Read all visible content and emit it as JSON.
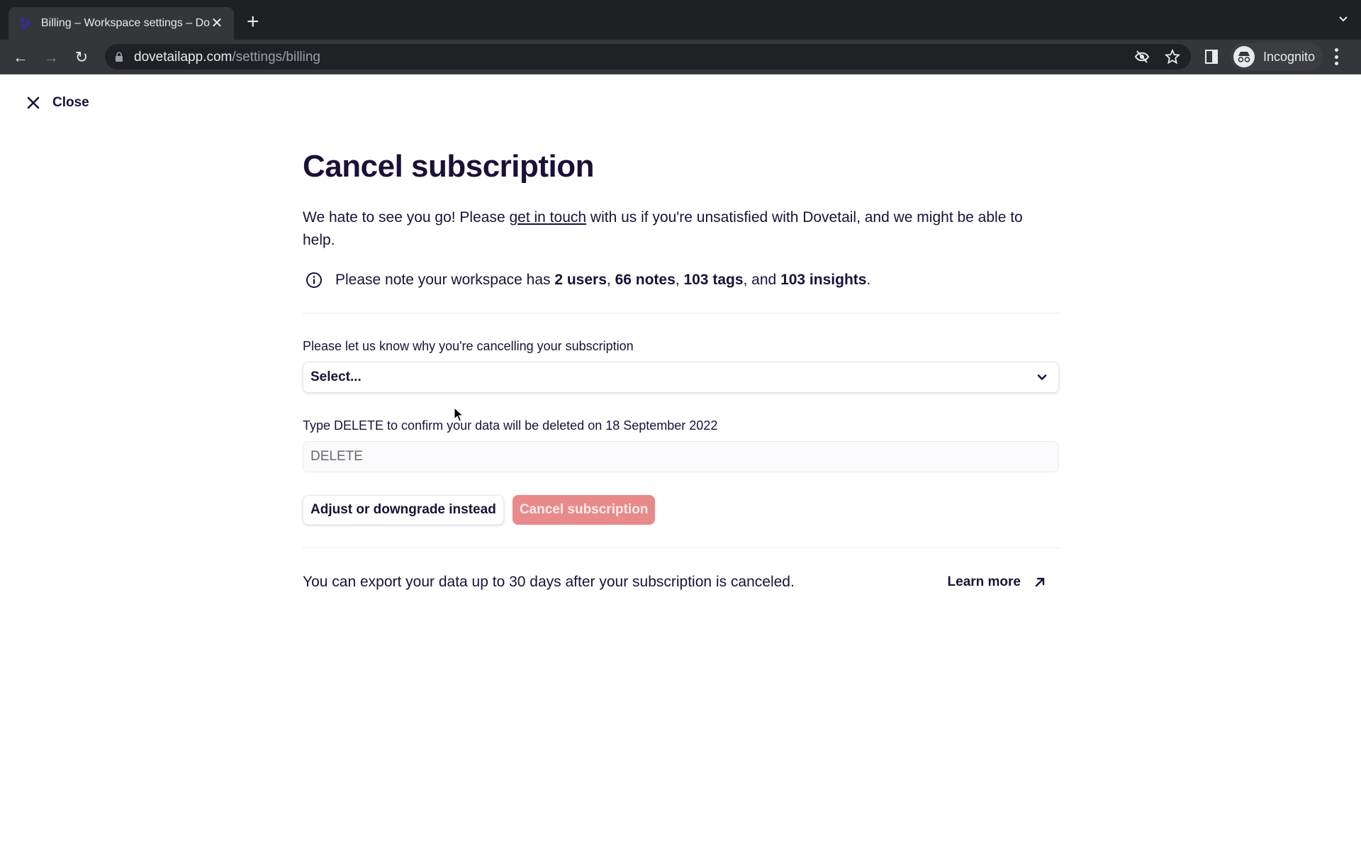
{
  "browser": {
    "tab_title": "Billing – Workspace settings – Dovetail",
    "url_domain": "dovetailapp.com",
    "url_path": "/settings/billing",
    "profile_label": "Incognito"
  },
  "page": {
    "close_label": "Close",
    "title": "Cancel subscription",
    "intro": {
      "before_link": "We hate to see you go! Please ",
      "link_text": "get in touch",
      "after_link": " with us if you're unsatisfied with Dovetail, and we might be able to help."
    },
    "note": {
      "prefix": "Please note your workspace has ",
      "users": "2 users",
      "notes": "66 notes",
      "tags": "103 tags",
      "insights": "103 insights",
      "sep1": ", ",
      "sep2": ", ",
      "sep3": ", and ",
      "suffix": "."
    },
    "reason_field": {
      "label": "Please let us know why you're cancelling your subscription",
      "selected_value": "Select..."
    },
    "confirm_field": {
      "label": "Type DELETE to confirm your data will be deleted on 18 September 2022",
      "value": "",
      "placeholder": "DELETE"
    },
    "buttons": {
      "secondary": "Adjust or downgrade instead",
      "danger": "Cancel subscription"
    },
    "footer": {
      "text": "You can export your data up to 30 days after your subscription is canceled.",
      "learn_more": "Learn more"
    }
  },
  "colors": {
    "text": "#1b1136",
    "danger_disabled": "#e88a8a"
  }
}
